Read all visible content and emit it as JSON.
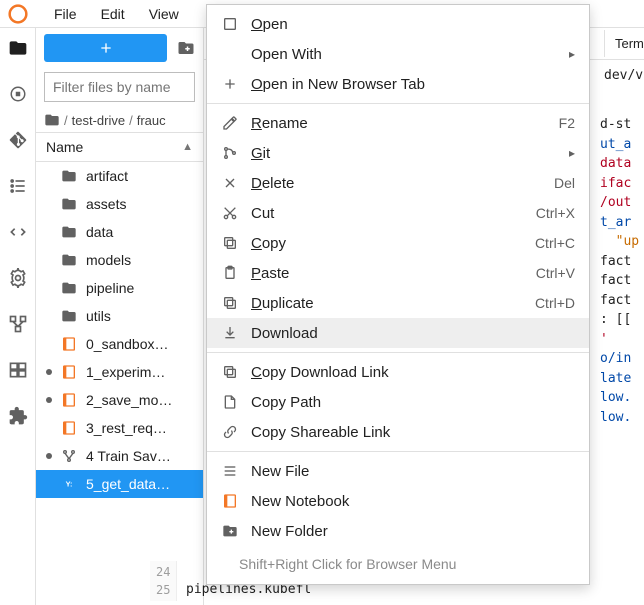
{
  "menubar": {
    "items": [
      "File",
      "Edit",
      "View"
    ]
  },
  "file_browser": {
    "filter_placeholder": "Filter files by name",
    "breadcrumb": {
      "seg1": "test-drive",
      "seg2": "frauc"
    },
    "column_header": "Name",
    "rows": [
      {
        "label": "artifact",
        "type": "folder",
        "dirty": false
      },
      {
        "label": "assets",
        "type": "folder",
        "dirty": false
      },
      {
        "label": "data",
        "type": "folder",
        "dirty": false
      },
      {
        "label": "models",
        "type": "folder",
        "dirty": false
      },
      {
        "label": "pipeline",
        "type": "folder",
        "dirty": false
      },
      {
        "label": "utils",
        "type": "folder",
        "dirty": false
      },
      {
        "label": "0_sandbox…",
        "type": "notebook",
        "dirty": false
      },
      {
        "label": "1_experim…",
        "type": "notebook",
        "dirty": true
      },
      {
        "label": "2_save_mo…",
        "type": "notebook",
        "dirty": true
      },
      {
        "label": "3_rest_req…",
        "type": "notebook",
        "dirty": false
      },
      {
        "label": "4 Train Sav…",
        "type": "pipeline",
        "dirty": true
      },
      {
        "label": "5_get_data…",
        "type": "py-yaml",
        "dirty": false,
        "selected": true
      }
    ]
  },
  "tabstrip": {
    "tab_terminal": "Termi"
  },
  "editor": {
    "path_fragment": "dev/v",
    "code_lines": [
      {
        "plain": "d-st"
      },
      {
        "blue": "ut_a"
      },
      {
        "red": "data"
      },
      {
        "red": "ifac"
      },
      {
        "red": "/out"
      },
      {
        "blue": "t_ar"
      },
      {
        "orange": "  \"up"
      },
      {
        "plain": "fact"
      },
      {
        "plain": "fact"
      },
      {
        "plain": "fact"
      },
      {
        "plain": ": [["
      },
      {
        "red": "'"
      },
      {
        "blue": "o/in"
      },
      {
        "blue": "late"
      },
      {
        "blue": "low."
      },
      {
        "blue": "low."
      }
    ],
    "gutter": [
      "24",
      "25"
    ],
    "last_line": "pipelines.kubefl"
  },
  "context_menu": {
    "items": [
      {
        "icon": "open",
        "label": "Open",
        "ul": true,
        "shortcut": "",
        "submenu": false
      },
      {
        "icon": "",
        "label": "Open With",
        "ul": false,
        "shortcut": "",
        "submenu": true
      },
      {
        "icon": "plus",
        "label": "Open in New Browser Tab",
        "ul": true,
        "shortcut": "",
        "submenu": false
      },
      "sep",
      {
        "icon": "rename",
        "label": "Rename",
        "ul": true,
        "shortcut": "F2",
        "submenu": false
      },
      {
        "icon": "git",
        "label": "Git",
        "ul": true,
        "shortcut": "",
        "submenu": true
      },
      {
        "icon": "delete",
        "label": "Delete",
        "ul": true,
        "shortcut": "Del",
        "submenu": false
      },
      {
        "icon": "cut",
        "label": "Cut",
        "ul": false,
        "shortcut": "Ctrl+X",
        "submenu": false
      },
      {
        "icon": "copy",
        "label": "Copy",
        "ul": true,
        "shortcut": "Ctrl+C",
        "submenu": false
      },
      {
        "icon": "paste",
        "label": "Paste",
        "ul": true,
        "shortcut": "Ctrl+V",
        "submenu": false
      },
      {
        "icon": "duplicate",
        "label": "Duplicate",
        "ul": true,
        "shortcut": "Ctrl+D",
        "submenu": false
      },
      {
        "icon": "download",
        "label": "Download",
        "ul": false,
        "shortcut": "",
        "submenu": false,
        "hover": true
      },
      "sep",
      {
        "icon": "link",
        "label": "Copy Download Link",
        "ul": true,
        "shortcut": "",
        "submenu": false
      },
      {
        "icon": "file",
        "label": "Copy Path",
        "ul": false,
        "shortcut": "",
        "submenu": false
      },
      {
        "icon": "share",
        "label": "Copy Shareable Link",
        "ul": false,
        "shortcut": "",
        "submenu": false
      },
      "sep",
      {
        "icon": "newfile",
        "label": "New File",
        "ul": false,
        "shortcut": "",
        "submenu": false
      },
      {
        "icon": "notebook",
        "label": "New Notebook",
        "ul": false,
        "shortcut": "",
        "submenu": false
      },
      {
        "icon": "newfolder",
        "label": "New Folder",
        "ul": false,
        "shortcut": "",
        "submenu": false
      }
    ],
    "hint": "Shift+Right Click for Browser Menu"
  },
  "colors": {
    "accent": "#2196f3",
    "jupyter_orange": "#f37726"
  }
}
